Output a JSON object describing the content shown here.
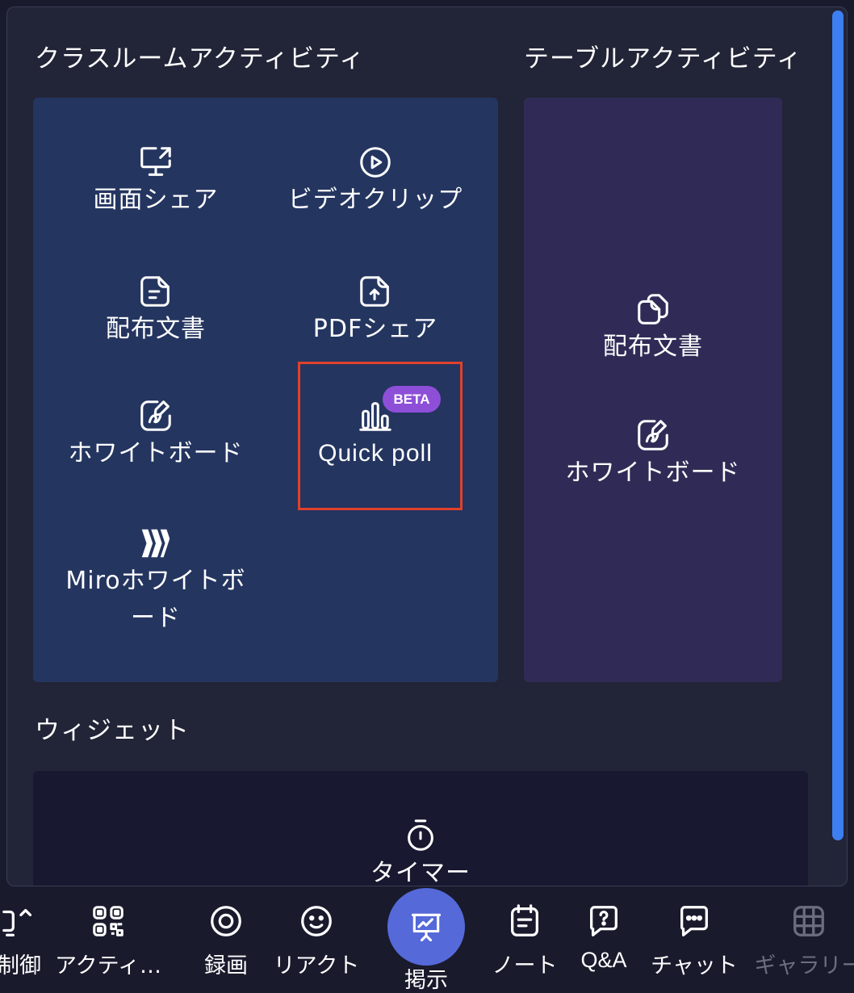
{
  "panel": {
    "classroom": {
      "title": "クラスルームアクティビティ",
      "items": [
        {
          "label": "画面シェア",
          "icon": "screen-share-icon"
        },
        {
          "label": "ビデオクリップ",
          "icon": "video-play-icon"
        },
        {
          "label": "配布文書",
          "icon": "document-icon"
        },
        {
          "label": "PDFシェア",
          "icon": "pdf-upload-icon"
        },
        {
          "label": "ホワイトボード",
          "icon": "whiteboard-icon"
        },
        {
          "label": "Quick poll",
          "icon": "bar-chart-icon",
          "badge": "BETA"
        },
        {
          "label": "Miroホワイトボード",
          "icon": "miro-logo-icon"
        }
      ]
    },
    "table": {
      "title": "テーブルアクティビティ",
      "items": [
        {
          "label": "配布文書",
          "icon": "documents-icon"
        },
        {
          "label": "ホワイトボード",
          "icon": "whiteboard-icon"
        }
      ]
    },
    "widgets": {
      "title": "ウィジェット",
      "items": [
        {
          "label": "タイマー",
          "icon": "timer-icon"
        }
      ]
    }
  },
  "toolbar": {
    "items": [
      {
        "label": "制御",
        "icon": "control-icon"
      },
      {
        "label": "アクティ…",
        "icon": "activity-qr-icon"
      },
      {
        "label": "録画",
        "icon": "record-icon"
      },
      {
        "label": "リアクト",
        "icon": "smile-icon"
      },
      {
        "label": "掲示",
        "icon": "presentation-icon"
      },
      {
        "label": "ノート",
        "icon": "notes-icon"
      },
      {
        "label": "Q&A",
        "icon": "question-icon"
      },
      {
        "label": "チャット",
        "icon": "chat-icon"
      },
      {
        "label": "ギャラリー",
        "icon": "grid-icon"
      }
    ]
  },
  "colors": {
    "panel_bg": "#222437",
    "classroom_card": "#243560",
    "table_card": "#302b56",
    "widget_card": "#181930",
    "highlight": "#e0412c",
    "beta_badge": "#8e4fd8",
    "present_button": "#5569d8",
    "scrollbar": "#3d7ef0"
  }
}
